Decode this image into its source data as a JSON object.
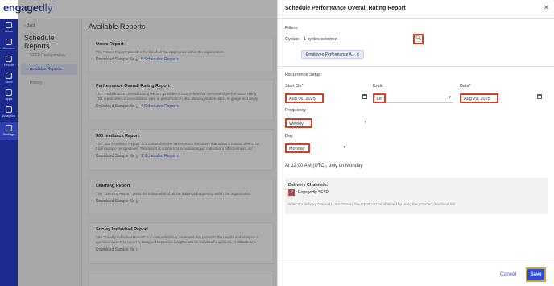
{
  "app": {
    "logo_main": "engaged",
    "logo_accent": "ly"
  },
  "rail": {
    "items": [
      {
        "label": "Home",
        "icon": "home-icon"
      },
      {
        "label": "Connect",
        "icon": "chat-icon"
      },
      {
        "label": "People",
        "icon": "people-icon"
      },
      {
        "label": "Store",
        "icon": "store-icon"
      },
      {
        "label": "Apps",
        "icon": "apps-icon"
      },
      {
        "label": "Analytics",
        "icon": "analytics-icon"
      },
      {
        "label": "Settings",
        "icon": "gear-icon"
      }
    ]
  },
  "subnav": {
    "back": "Back",
    "title": "Schedule Reports",
    "items": [
      "SFTP Configuration",
      "Available Reports",
      "History"
    ]
  },
  "main": {
    "title": "Available Reports",
    "reports": [
      {
        "title": "Users Report",
        "line1": "The \"Users Report\" provides the list of all the employees within the organization.",
        "line2": "",
        "download": "Download Sample file",
        "scheduled": "5 Scheduled Reports"
      },
      {
        "title": "Performance Overall Rating Report",
        "line1": "The \"Performance Overall Rating Report\" provides a comprehensive overview of performance rating",
        "line2": "This report offers a consolidated view of performance data, allowing stakeholders to gauge and analy",
        "download": "Download Sample file",
        "scheduled": "4 Scheduled Reports"
      },
      {
        "title": "360 feedback Report",
        "line1": "The \"360 Feedback Report\" is a comprehensive assessment document that offers a holistic view of an",
        "line2": "from multiple perspectives. This report is critical tool in evaluating an individual's effectiveness, str",
        "download": "Download Sample file",
        "scheduled": "1 Scheduled Reports"
      },
      {
        "title": "Learning Report",
        "line1": "The \"Learning Report\" gives the information of all the trainings happening within the organization",
        "line2": "",
        "download": "Download Sample file",
        "scheduled": ""
      },
      {
        "title": "Survey Individual Report",
        "line1": "The \"Survey Individual Report\" is a comprehensive document that presents the results and analysis o",
        "line2": "questionnaire. This report is designed to provide insights into an individual's opinions, feedback, or e",
        "download": "Download Sample file",
        "scheduled": ""
      }
    ]
  },
  "modal": {
    "title": "Schedule Performance Overall Rating Report",
    "filters_label": "Filters:",
    "cycles_label": "Cycles:",
    "cycles_value": "1 cycles selected",
    "chip": "Employee Performance A...",
    "recurrence_label": "Recurrence Setup:",
    "start_label": "Start On*",
    "start_value": "Aug 06, 2025",
    "ends_label": "Ends",
    "ends_value": "On",
    "date_label": "Date*",
    "date_value": "Aug 29, 2025",
    "frequency_label": "Frequency",
    "frequency_value": "Weekly",
    "day_label": "Day",
    "day_value": "Monday",
    "summary": "At 12:00 AM (UTC), only on Monday",
    "delivery_label": "Delivery Channels:",
    "sftp_label": "Engagedly SFTP",
    "note": "Note: If a delivery channel is not chosen, the report can be obtained by using the provided download link.",
    "cancel": "Cancel",
    "save": "Save"
  },
  "colors": {
    "brand": "#1d2b8f",
    "accent": "#2d4bd6",
    "highlight": "#d23f2a"
  }
}
